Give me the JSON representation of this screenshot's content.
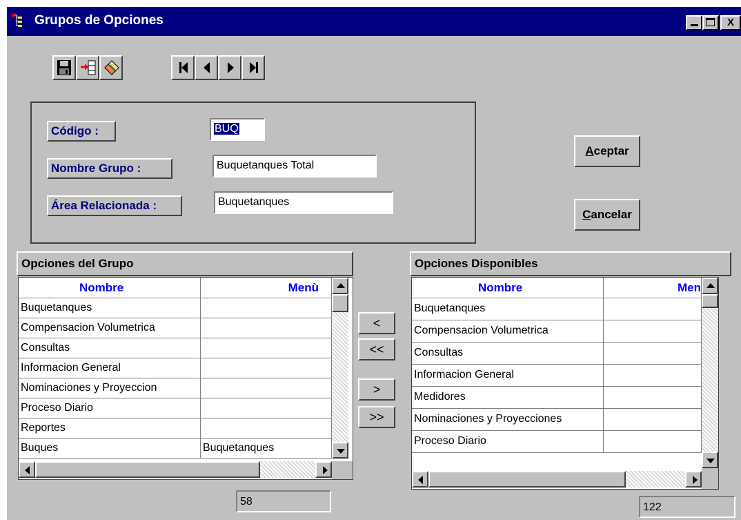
{
  "window": {
    "title": "Grupos de Opciones",
    "controls": {
      "minimize": "_",
      "maximize": "□",
      "close": "X"
    },
    "title_icon": "app-tree-icon"
  },
  "toolbar": {
    "icons": [
      "save-icon",
      "insert-record-icon",
      "eraser-icon",
      "first-record-icon",
      "previous-record-icon",
      "next-record-icon",
      "last-record-icon"
    ]
  },
  "form": {
    "codigo": {
      "label": "Código :",
      "value": "BUQ"
    },
    "nombre_grupo": {
      "label": "Nombre Grupo :",
      "value": "Buquetanques Total"
    },
    "area_relacionada": {
      "label": "Área Relacionada :",
      "value": "Buquetanques"
    }
  },
  "buttons": {
    "aceptar": {
      "mnemonic": "A",
      "rest": "ceptar"
    },
    "cancelar": {
      "mnemonic": "C",
      "rest": "ancelar"
    }
  },
  "opciones_grupo": {
    "title": "Opciones del Grupo",
    "columns": [
      "Nombre",
      "Menù"
    ],
    "rows": [
      [
        "Buquetanques",
        ""
      ],
      [
        "Compensacion Volumetrica",
        ""
      ],
      [
        "Consultas",
        ""
      ],
      [
        "Informacion General",
        ""
      ],
      [
        "Nominaciones y Proyeccion",
        ""
      ],
      [
        "Proceso Diario",
        ""
      ],
      [
        "Reportes",
        ""
      ],
      [
        "Buques",
        "Buquetanques"
      ]
    ],
    "count": "58"
  },
  "move_buttons": [
    "<",
    "<<",
    ">",
    ">>"
  ],
  "opciones_disponibles": {
    "title": "Opciones Disponibles",
    "columns": [
      "Nombre",
      "Men"
    ],
    "rows": [
      [
        "Buquetanques",
        ""
      ],
      [
        "Compensacion Volumetrica",
        ""
      ],
      [
        "Consultas",
        ""
      ],
      [
        "Informacion General",
        ""
      ],
      [
        "Medidores",
        ""
      ],
      [
        "Nominaciones y Proyecciones",
        ""
      ],
      [
        "Proceso Diario",
        ""
      ]
    ],
    "count": "122"
  },
  "colors": {
    "title_bar": "#000080",
    "face": "#c0c0c0",
    "label_text": "#000080",
    "header_text": "#0000ff"
  }
}
